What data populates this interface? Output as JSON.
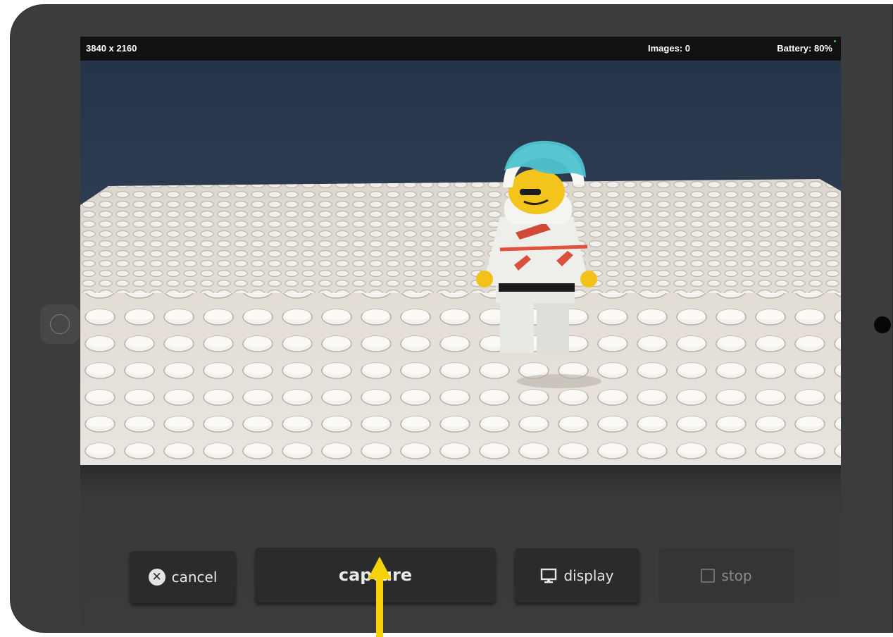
{
  "status_bar": {
    "resolution": "3840 x 2160",
    "images": "Images: 0",
    "battery": "Battery: 80%"
  },
  "buttons": {
    "cancel": {
      "label": "cancel",
      "icon": "x-circle-icon"
    },
    "capture": {
      "label": "capture"
    },
    "display": {
      "label": "display",
      "icon": "monitor-icon"
    },
    "stop": {
      "label": "stop",
      "icon": "square-icon",
      "enabled": false
    }
  },
  "annotation": {
    "color": "#f5d20c",
    "icon": "arrow-up-icon",
    "target": "capture"
  },
  "preview": {
    "subject": "lego-minifigure-on-white-baseplate"
  }
}
